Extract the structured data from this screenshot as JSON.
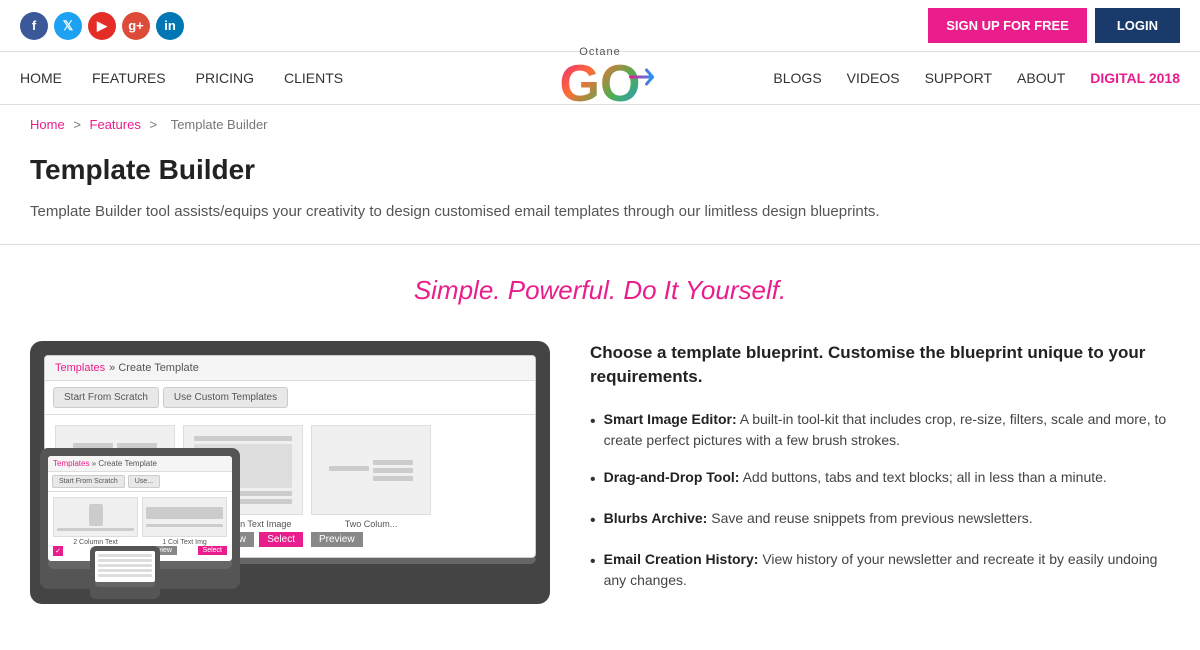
{
  "social": {
    "icons": [
      {
        "id": "facebook",
        "label": "f",
        "class": "social-fb",
        "title": "Facebook"
      },
      {
        "id": "twitter",
        "label": "t",
        "class": "social-tw",
        "title": "Twitter"
      },
      {
        "id": "youtube",
        "label": "▶",
        "class": "social-yt",
        "title": "YouTube"
      },
      {
        "id": "googleplus",
        "label": "g+",
        "class": "social-gp",
        "title": "Google Plus"
      },
      {
        "id": "linkedin",
        "label": "in",
        "class": "social-li",
        "title": "LinkedIn"
      }
    ]
  },
  "topbar": {
    "signup_label": "SIGN UP FOR FREE",
    "login_label": "LOGIN"
  },
  "nav": {
    "logo_octane": "Octane",
    "logo_go": "GO",
    "left_links": [
      {
        "id": "home",
        "label": "HOME"
      },
      {
        "id": "features",
        "label": "FEATURES"
      },
      {
        "id": "pricing",
        "label": "PRICING"
      },
      {
        "id": "clients",
        "label": "CLIENTS"
      }
    ],
    "right_links": [
      {
        "id": "blogs",
        "label": "BLOGS"
      },
      {
        "id": "videos",
        "label": "VIDEOS"
      },
      {
        "id": "support",
        "label": "SUPPORT"
      },
      {
        "id": "about",
        "label": "ABOUT"
      },
      {
        "id": "digital2018",
        "label": "DIGITAL 2018",
        "highlight": true
      }
    ]
  },
  "breadcrumb": {
    "home": "Home",
    "features": "Features",
    "current": "Template Builder"
  },
  "page": {
    "title": "Template Builder",
    "description": "Template Builder tool assists/equips your creativity to design customised email templates through our limitless design blueprints.",
    "tagline": "Simple. Powerful. Do It Yourself."
  },
  "screenshot": {
    "breadcrumb": "Templates » Create Template",
    "tab1": "Start From Scratch",
    "tab2": "Use Custom Templates",
    "templates": [
      {
        "label": "Two Column Text",
        "select": true
      },
      {
        "label": "One Column Text Image",
        "preview": true,
        "select": true
      },
      {
        "label": "Two Colum...",
        "preview": true
      }
    ]
  },
  "content": {
    "heading": "Choose a template blueprint. Customise the blueprint unique to your requirements.",
    "features": [
      {
        "name": "Smart Image Editor:",
        "desc": "A built-in tool-kit that includes crop, re-size, filters, scale and more, to create perfect pictures with a few brush strokes."
      },
      {
        "name": "Drag-and-Drop Tool:",
        "desc": "Add buttons, tabs and text blocks; all in less than a minute."
      },
      {
        "name": "Blurbs Archive:",
        "desc": "Save and reuse snippets from previous newsletters."
      },
      {
        "name": "Email Creation History:",
        "desc": "View history of your newsletter and recreate it by easily undoing any changes."
      }
    ]
  }
}
